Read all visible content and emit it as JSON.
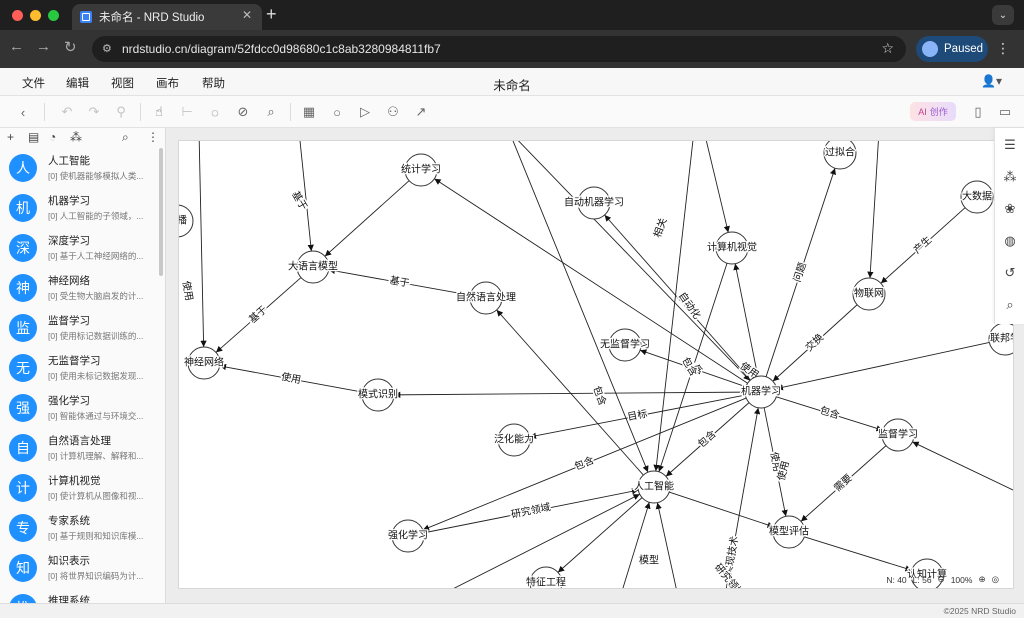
{
  "browser": {
    "tab_title": "未命名 - NRD Studio",
    "url": "nrdstudio.cn/diagram/52fdcc0d98680c1c8ab3280984811fb7",
    "profile_status": "Paused",
    "colors": {
      "traffic_red": "#ff5f57",
      "traffic_yellow": "#febc2e",
      "traffic_green": "#28c840"
    }
  },
  "menu": {
    "items": [
      "文件",
      "编辑",
      "视图",
      "画布",
      "帮助"
    ],
    "doc_title": "未命名"
  },
  "toolbar": {
    "ai_label": "AI",
    "ai_sub": "创作"
  },
  "sidebar": {
    "items": [
      {
        "avatar": "人",
        "name": "人工智能",
        "desc": "[0] 使机器能够模拟人类..."
      },
      {
        "avatar": "机",
        "name": "机器学习",
        "desc": "[0] 人工智能的子领域，..."
      },
      {
        "avatar": "深",
        "name": "深度学习",
        "desc": "[0] 基于人工神经网络的..."
      },
      {
        "avatar": "神",
        "name": "神经网络",
        "desc": "[0] 受生物大脑启发的计..."
      },
      {
        "avatar": "监",
        "name": "监督学习",
        "desc": "[0] 使用标记数据训练的..."
      },
      {
        "avatar": "无",
        "name": "无监督学习",
        "desc": "[0] 使用未标记数据发现..."
      },
      {
        "avatar": "强",
        "name": "强化学习",
        "desc": "[0] 智能体通过与环境交..."
      },
      {
        "avatar": "自",
        "name": "自然语言处理",
        "desc": "[0] 计算机理解、解释和..."
      },
      {
        "avatar": "计",
        "name": "计算机视觉",
        "desc": "[0] 使计算机从图像和视..."
      },
      {
        "avatar": "专",
        "name": "专家系统",
        "desc": "[0] 基于规则和知识库模..."
      },
      {
        "avatar": "知",
        "name": "知识表示",
        "desc": "[0] 将世界知识编码为计..."
      },
      {
        "avatar": "推",
        "name": "推理系统",
        "desc": ""
      }
    ]
  },
  "graph": {
    "nodes": [
      {
        "id": "ai",
        "label": "人工智能"
      },
      {
        "id": "ml",
        "label": "机器学习"
      },
      {
        "id": "nn",
        "label": "神经网络"
      },
      {
        "id": "sl",
        "label": "监督学习"
      },
      {
        "id": "ul",
        "label": "无监督学习"
      },
      {
        "id": "rl",
        "label": "强化学习"
      },
      {
        "id": "nlp",
        "label": "自然语言处理"
      },
      {
        "id": "cv",
        "label": "计算机视觉"
      },
      {
        "id": "llm",
        "label": "大语言模型"
      },
      {
        "id": "stat",
        "label": "统计学习"
      },
      {
        "id": "automl",
        "label": "自动机器学习"
      },
      {
        "id": "overfit",
        "label": "过拟合"
      },
      {
        "id": "bigdata",
        "label": "大数据"
      },
      {
        "id": "iot",
        "label": "物联网"
      },
      {
        "id": "fed",
        "label": "联邦学"
      },
      {
        "id": "pattern",
        "label": "模式识别"
      },
      {
        "id": "gen",
        "label": "泛化能力"
      },
      {
        "id": "eval",
        "label": "模型评估"
      },
      {
        "id": "feat",
        "label": "特征工程"
      },
      {
        "id": "cog",
        "label": "认知计算"
      },
      {
        "id": "prop",
        "label": "传播"
      }
    ],
    "edges": [
      {
        "from": "stat",
        "to": "llm",
        "label": ""
      },
      {
        "from": "nlp",
        "to": "llm",
        "label": "基于"
      },
      {
        "from": "llm",
        "to": "nn",
        "label": "基于"
      },
      {
        "from": "ml",
        "to": "stat",
        "label": ""
      },
      {
        "from": "ml",
        "to": "automl",
        "label": ""
      },
      {
        "from": "ml",
        "to": "ul",
        "label": "包含"
      },
      {
        "from": "ml",
        "to": "pattern",
        "label": ""
      },
      {
        "from": "ml",
        "to": "gen",
        "label": "目标"
      },
      {
        "from": "ml",
        "to": "rl",
        "label": "包含"
      },
      {
        "from": "ml",
        "to": "sl",
        "label": "包含"
      },
      {
        "from": "ml",
        "to": "eval",
        "label": "使用"
      },
      {
        "from": "ml",
        "to": "overfit",
        "label": "问题"
      },
      {
        "from": "iot",
        "to": "ml",
        "label": "交换"
      },
      {
        "from": "fed",
        "to": "ml",
        "label": ""
      },
      {
        "from": "bigdata",
        "to": "iot",
        "label": "产生"
      },
      {
        "from": "ml",
        "to": "cv",
        "label": ""
      },
      {
        "from": "ml",
        "to": "ai",
        "label": "包含"
      },
      {
        "from": "pattern",
        "to": "nn",
        "label": "使用"
      },
      {
        "from": "ai",
        "to": "nlp",
        "label": ""
      },
      {
        "from": "ai",
        "to": "eval",
        "label": ""
      },
      {
        "from": "sl",
        "to": "eval",
        "label": "需要"
      },
      {
        "from": "eval",
        "to": "cog",
        "label": ""
      },
      {
        "from": "ai",
        "to": "feat",
        "label": ""
      },
      {
        "from": "rl",
        "to": "ai",
        "label": "研究领域"
      },
      {
        "from": "cv",
        "to": "ai",
        "label": ""
      }
    ],
    "extra_labels": [
      "相关",
      "自动化",
      "包含",
      "使用",
      "实现技术",
      "研究领域",
      "模型",
      "使用",
      "基于",
      "属于",
      "使用",
      "包含"
    ]
  },
  "status": {
    "nodes": "N: 40",
    "links": "L: 56",
    "zoom": "100%"
  },
  "footer": "©2025 NRD Studio",
  "colors": {
    "avatar_bg": "#1e90ff",
    "node_stroke": "#333333"
  }
}
